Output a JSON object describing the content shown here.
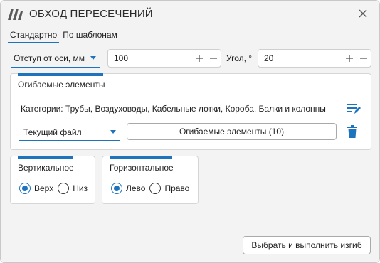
{
  "window": {
    "title": "ОБХОД ПЕРЕСЕЧЕНИЙ",
    "logo_icon": "app-logo-icon",
    "close_icon": "close-icon"
  },
  "tabs": [
    {
      "label": "Стандартно",
      "active": true
    },
    {
      "label": "По шаблонам",
      "active": false
    }
  ],
  "offset": {
    "mode_selected": "Отступ от оси, мм",
    "value": "100",
    "angle_label": "Угол, °",
    "angle_value": "20"
  },
  "wrapped_elements": {
    "title": "Огибаемые элементы",
    "categories_text": "Категории: Трубы, Воздуховоды, Кабельные лотки, Короба, Балки и колонны",
    "source_selected": "Текущий файл",
    "elements_button": "Огибаемые элементы (10)"
  },
  "vertical": {
    "title": "Вертикальное",
    "options": [
      "Верх",
      "Низ"
    ],
    "selected": "Верх"
  },
  "horizontal": {
    "title": "Горизонтальное",
    "options": [
      "Лево",
      "Право"
    ],
    "selected": "Лево"
  },
  "actions": {
    "execute_label": "Выбрать и выполнить изгиб"
  },
  "colors": {
    "accent": "#1e73be",
    "background": "#f3f3f3",
    "panel": "#ffffff"
  }
}
